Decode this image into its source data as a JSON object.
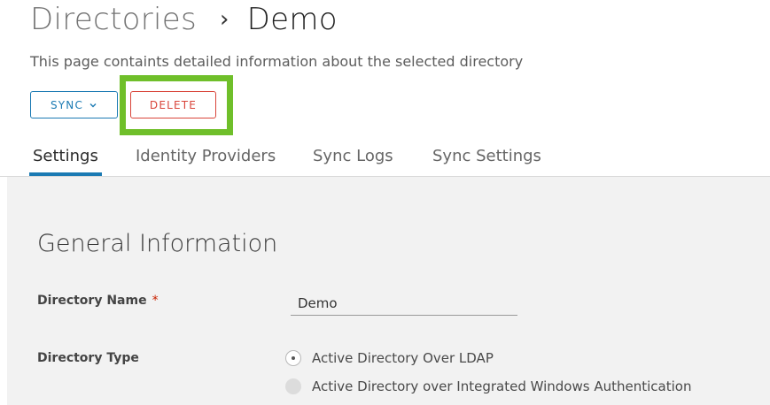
{
  "breadcrumb": {
    "parent": "Directories",
    "separator": "›",
    "current": "Demo"
  },
  "description": "This page containts detailed information about the selected directory",
  "actions": {
    "sync_label": "SYNC",
    "delete_label": "DELETE"
  },
  "tabs": [
    {
      "label": "Settings",
      "active": true
    },
    {
      "label": "Identity Providers",
      "active": false
    },
    {
      "label": "Sync Logs",
      "active": false
    },
    {
      "label": "Sync Settings",
      "active": false
    }
  ],
  "general": {
    "title": "General Information",
    "directory_name": {
      "label": "Directory Name",
      "required_mark": "*",
      "value": "Demo"
    },
    "directory_type": {
      "label": "Directory Type",
      "options": [
        {
          "label": "Active Directory Over LDAP",
          "selected": true
        },
        {
          "label": "Active Directory over Integrated Windows Authentication",
          "selected": false
        }
      ]
    }
  },
  "colors": {
    "accent": "#1b7ab3",
    "danger": "#d9453a",
    "highlight": "#6fbf2a",
    "content_bg": "#f2f2f2"
  }
}
